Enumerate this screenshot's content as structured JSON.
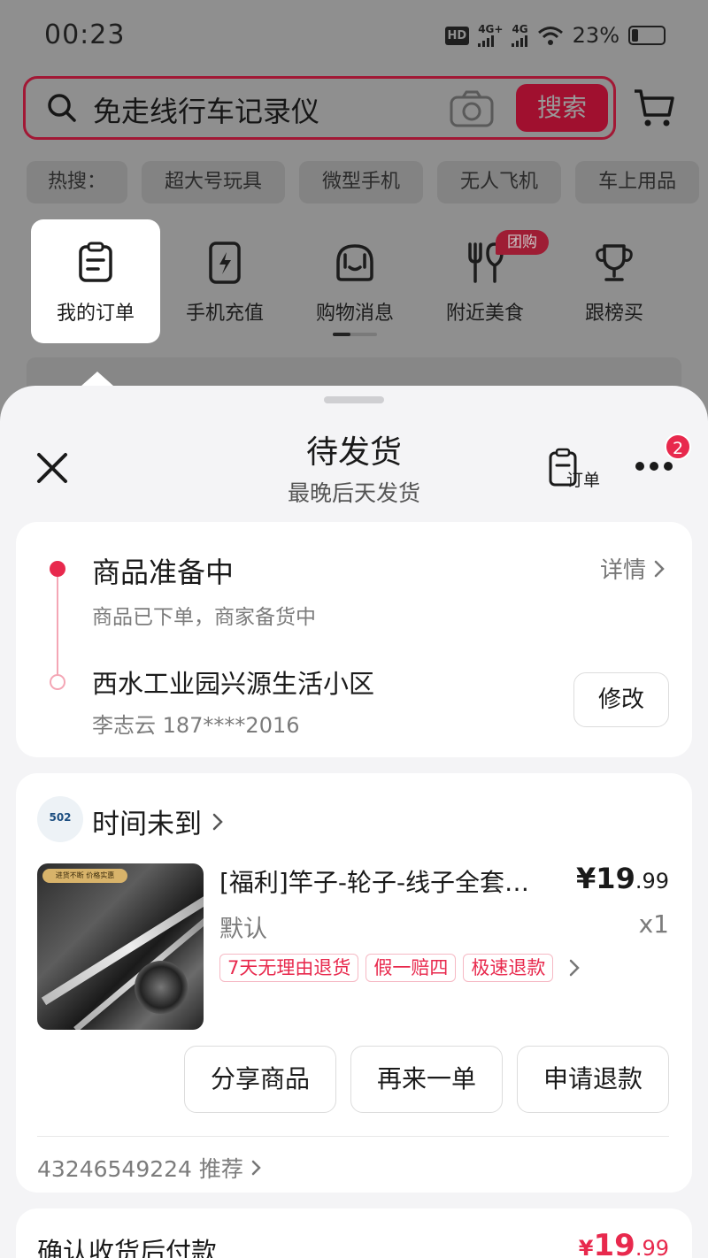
{
  "status_bar": {
    "time": "00:23",
    "hd": "HD",
    "net1": "4G+",
    "net2": "4G",
    "battery": "23%"
  },
  "search": {
    "query": "免走线行车记录仪",
    "button": "搜索"
  },
  "hot_search": {
    "label": "热搜：",
    "items": [
      "超大号玩具",
      "微型手机",
      "无人飞机",
      "车上用品"
    ]
  },
  "quick_menu": {
    "items": [
      {
        "label": "我的订单",
        "icon": "order-list-icon"
      },
      {
        "label": "手机充值",
        "icon": "phone-recharge-icon"
      },
      {
        "label": "购物消息",
        "icon": "shopping-message-icon"
      },
      {
        "label": "附近美食",
        "icon": "fork-knife-icon"
      },
      {
        "label": "跟榜买",
        "icon": "trophy-icon"
      }
    ],
    "group_badge": "团购"
  },
  "sheet": {
    "title": "待发货",
    "subtitle": "最晚后天发货",
    "order_button": "订单",
    "more_badge": "2"
  },
  "order_status": {
    "title": "商品准备中",
    "desc": "商品已下单，商家备货中",
    "detail_link": "详情",
    "address": "西水工业园兴源生活小区",
    "contact": "李志云 187****2016",
    "modify_button": "修改"
  },
  "goods_card": {
    "shop_logo_text": "502",
    "shop_name": "时间未到",
    "image_banner": "进货不断 价格实惠",
    "title": "[福利]竿子-轮子-线子全套…",
    "price_int": "¥19",
    "price_dec": ".99",
    "spec": "默认",
    "qty": "x1",
    "tags": [
      "7天无理由退货",
      "假一赔四",
      "极速退款"
    ],
    "actions": [
      "分享商品",
      "再来一单",
      "申请退款"
    ],
    "order_no": "43246549224 推荐"
  },
  "payment": {
    "label": "确认收货后付款",
    "currency": "¥",
    "amount_int": "19",
    "amount_dec": ".99"
  },
  "colors": {
    "accent": "#e8294d",
    "overlay": "#8f8f8f",
    "sheet_bg": "#f4f4f6"
  }
}
